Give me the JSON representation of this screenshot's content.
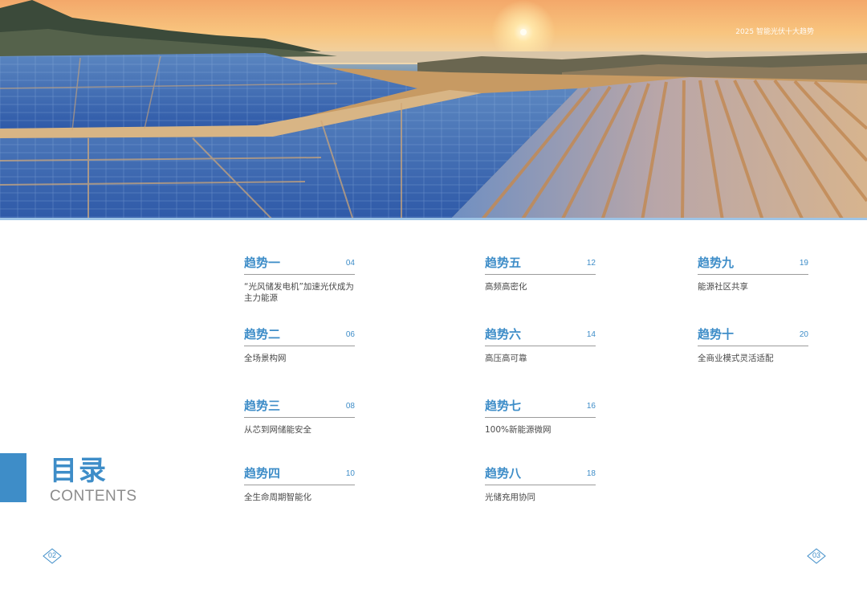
{
  "header": {
    "report_title": "2025 智能光伏十大趋势"
  },
  "title": {
    "cn": "目录",
    "en": "CONTENTS"
  },
  "toc": [
    {
      "name": "趋势一",
      "page": "04",
      "desc": "“光风储发电机”加速光伏成为主力能源"
    },
    {
      "name": "趋势二",
      "page": "06",
      "desc": "全场景构网"
    },
    {
      "name": "趋势三",
      "page": "08",
      "desc": "从芯到网储能安全"
    },
    {
      "name": "趋势四",
      "page": "10",
      "desc": "全生命周期智能化"
    },
    {
      "name": "趋势五",
      "page": "12",
      "desc": "高频高密化"
    },
    {
      "name": "趋势六",
      "page": "14",
      "desc": "高压高可靠"
    },
    {
      "name": "趋势七",
      "page": "16",
      "desc": "100%新能源微网"
    },
    {
      "name": "趋势八",
      "page": "18",
      "desc": "光储充用协同"
    },
    {
      "name": "趋势九",
      "page": "19",
      "desc": "能源社区共享"
    },
    {
      "name": "趋势十",
      "page": "20",
      "desc": "全商业模式灵活适配"
    }
  ],
  "footer": {
    "left_page": "02",
    "right_page": "03"
  },
  "colors": {
    "accent": "#3e8dc8",
    "rule": "#9c9c9c",
    "text": "#4a4a4a",
    "subtitle": "#8c8c8c"
  },
  "image": {
    "subject": "solar-farm-at-sunset-photo"
  }
}
